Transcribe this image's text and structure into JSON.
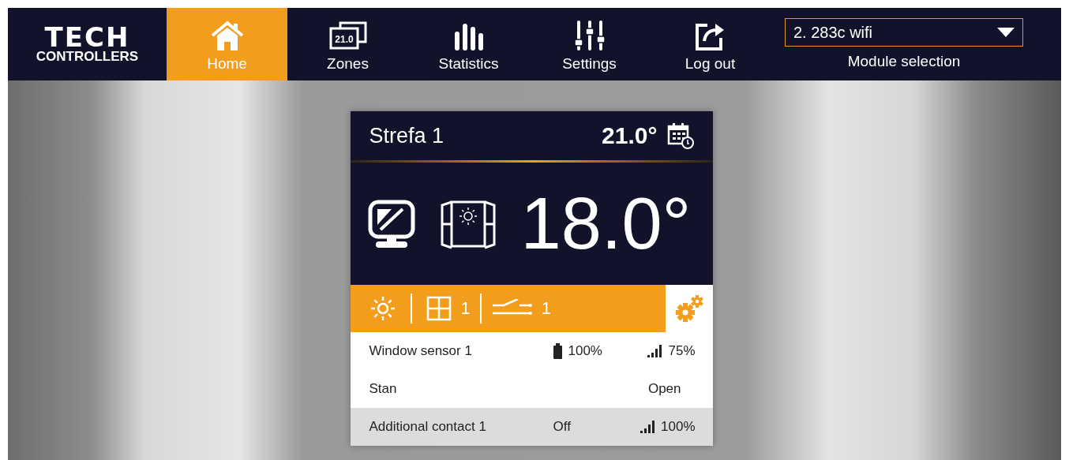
{
  "logo": {
    "line_1": "TECH",
    "line_2": "CONTROLLERS"
  },
  "nav": [
    {
      "label": "Home",
      "kind": "home",
      "selected": true
    },
    {
      "label": "Zones",
      "kind": "zones",
      "icon_text": "21.0",
      "selected": false
    },
    {
      "label": "Statistics",
      "kind": "statistics",
      "selected": false
    },
    {
      "label": "Settings",
      "kind": "settings",
      "selected": false
    },
    {
      "label": "Log out",
      "kind": "logout",
      "selected": false
    }
  ],
  "module": {
    "value": "2. 283c wifi",
    "label": "Module selection"
  },
  "zone": {
    "name": "Strefa 1",
    "target": "21.0°",
    "current": "18.0°",
    "window_count": "1",
    "contact_count": "1",
    "rows": [
      {
        "kind": "sensor",
        "name": "Window sensor 1",
        "battery": "100%",
        "signal": "75%"
      },
      {
        "kind": "state",
        "name": "Stan",
        "value": "Open"
      },
      {
        "kind": "contact",
        "name": "Additional contact 1",
        "value": "Off",
        "signal": "100%"
      }
    ]
  }
}
